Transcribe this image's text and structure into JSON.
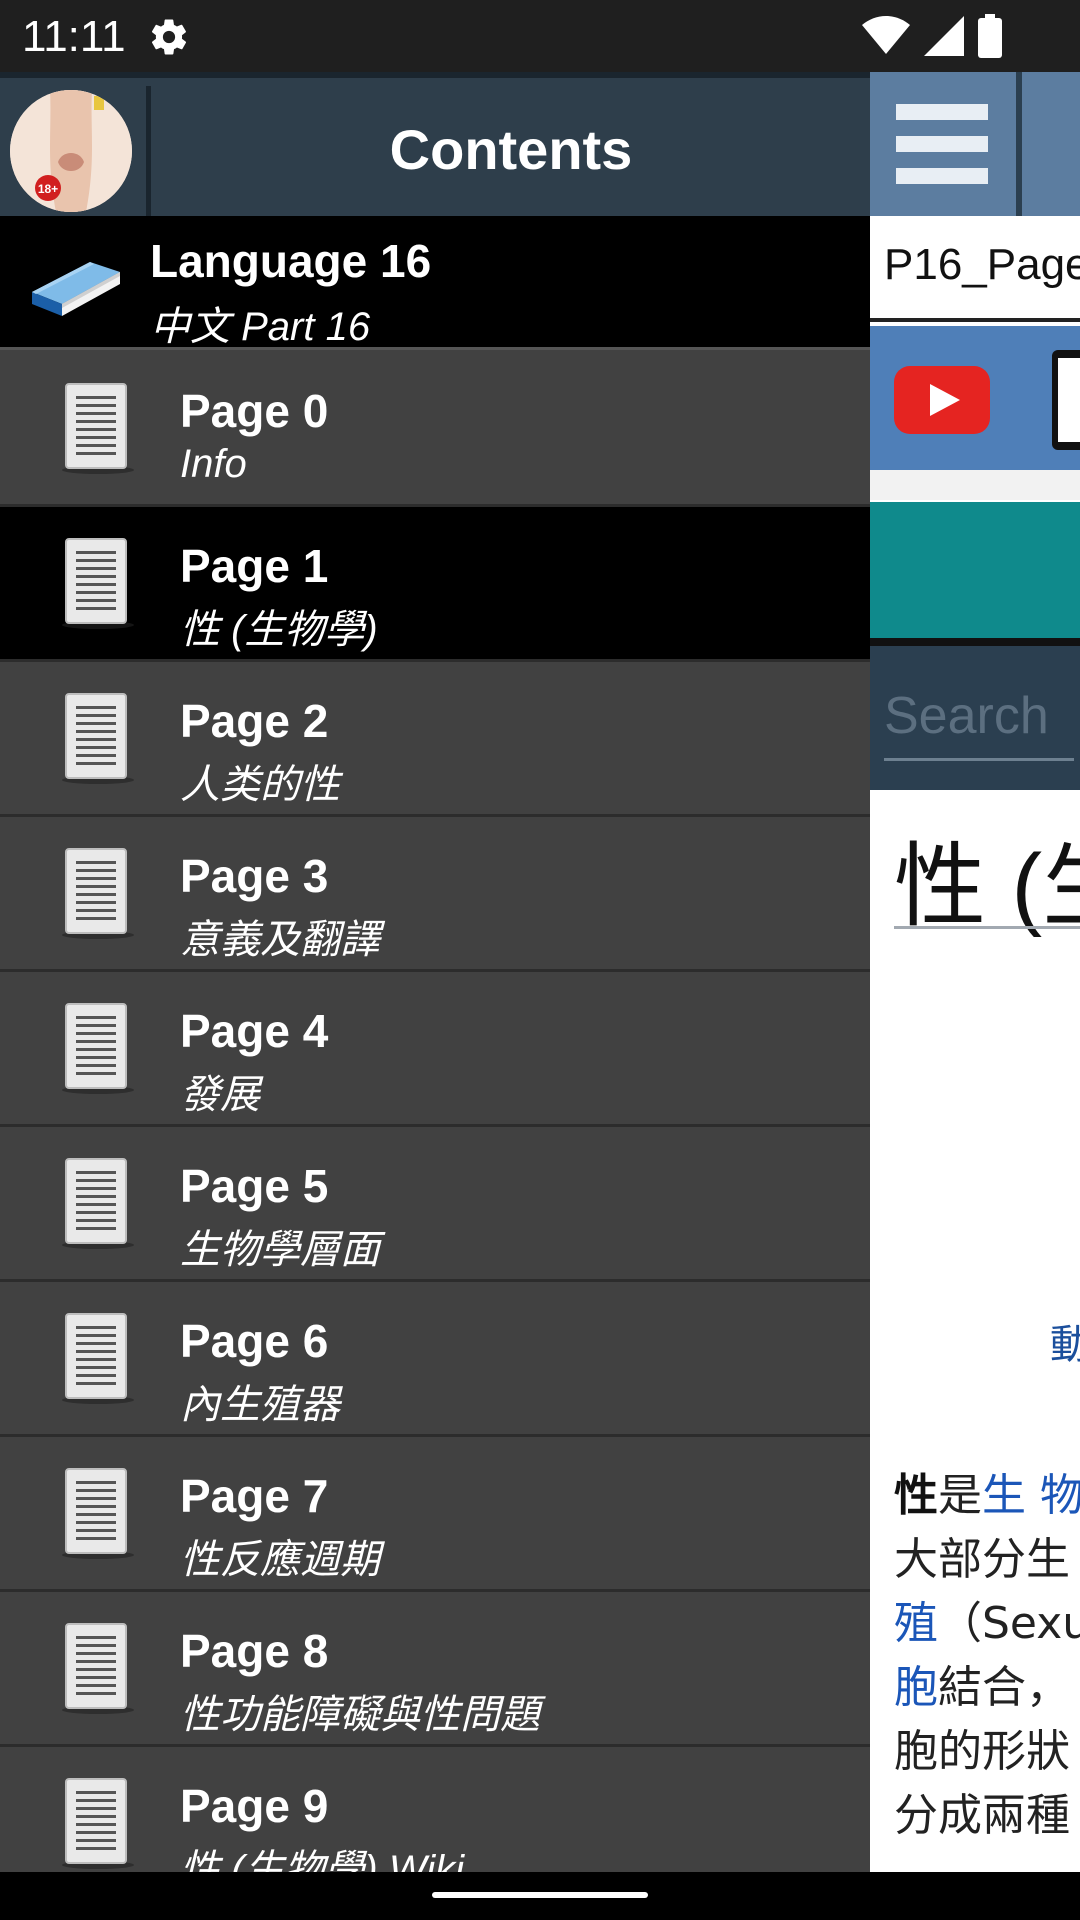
{
  "status_bar": {
    "time": "11:11",
    "icons": [
      "gear-icon",
      "wifi-icon",
      "signal-icon",
      "battery-icon"
    ]
  },
  "drawer": {
    "title": "Contents",
    "avatar_badge": "18+",
    "language": {
      "title": "Language 16",
      "subtitle": "中文 Part 16"
    },
    "pages": [
      {
        "title": "Page 0",
        "subtitle": "Info"
      },
      {
        "title": "Page 1",
        "subtitle": "性 (生物學)",
        "selected": true
      },
      {
        "title": "Page 2",
        "subtitle": "人类的性"
      },
      {
        "title": "Page 3",
        "subtitle": "意義及翻譯"
      },
      {
        "title": "Page 4",
        "subtitle": "發展"
      },
      {
        "title": "Page 5",
        "subtitle": "生物學層面"
      },
      {
        "title": "Page 6",
        "subtitle": "內生殖器"
      },
      {
        "title": "Page 7",
        "subtitle": "性反應週期"
      },
      {
        "title": "Page 8",
        "subtitle": "性功能障礙與性問題"
      },
      {
        "title": "Page 9",
        "subtitle": "性 (生物學) Wiki"
      }
    ]
  },
  "background_app": {
    "page_title": "P16_Page",
    "search_placeholder": "Search",
    "heading": "性 (生",
    "link_glyph": "動",
    "paragraph": {
      "line1_bold": "性",
      "line1_text": "是",
      "line1_link": "生 物",
      "line2": "大部分生",
      "line3_link": "殖",
      "line3_text": "（Sexu",
      "line4_link": "胞",
      "line4_text": "結合，",
      "line5": "胞的形狀",
      "line6": "分成兩種"
    }
  },
  "colors": {
    "drawer_bg": "#414141",
    "header_bg": "#2e3e4b",
    "selected_row": "#000000",
    "toolbar_blue": "#5c7da0",
    "teal": "#0f8a8c",
    "link": "#1b56b8"
  }
}
